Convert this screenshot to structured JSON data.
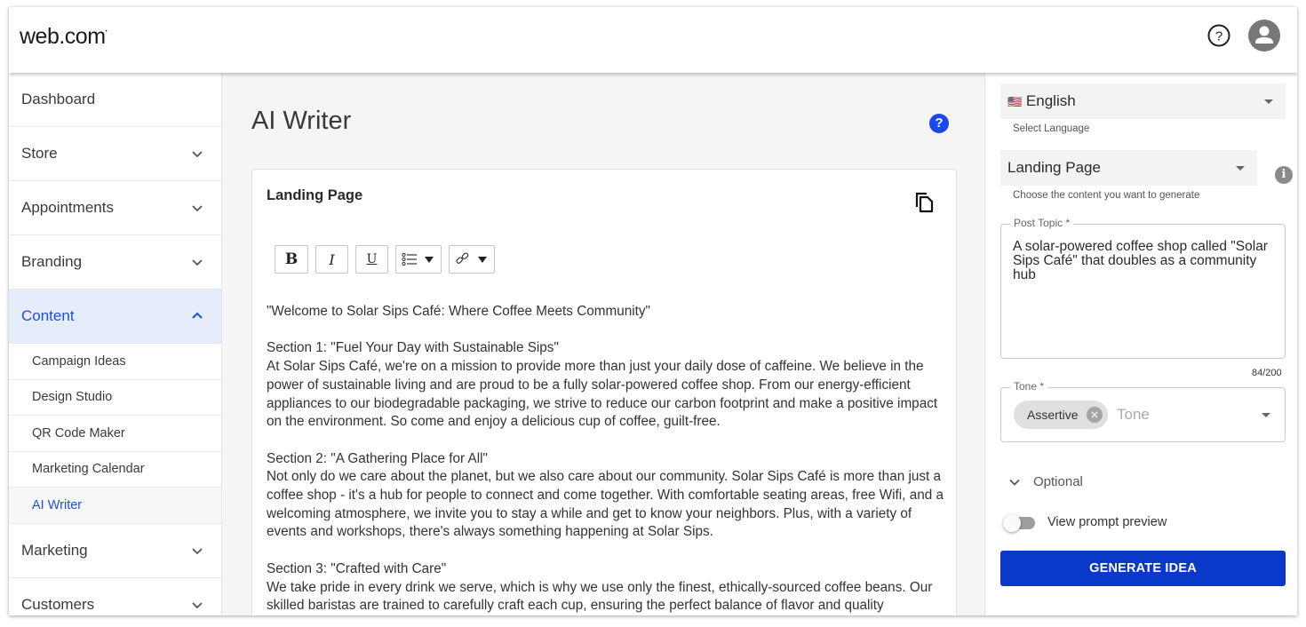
{
  "header": {
    "logo": "web.com",
    "help_icon": "help-circle-icon",
    "avatar_icon": "user-avatar-icon"
  },
  "sidebar": {
    "items": [
      {
        "label": "Dashboard",
        "expandable": false
      },
      {
        "label": "Store",
        "expandable": true,
        "expanded": false
      },
      {
        "label": "Appointments",
        "expandable": true,
        "expanded": false
      },
      {
        "label": "Branding",
        "expandable": true,
        "expanded": false
      },
      {
        "label": "Content",
        "expandable": true,
        "expanded": true,
        "active": true
      },
      {
        "label": "Marketing",
        "expandable": true,
        "expanded": false
      },
      {
        "label": "Customers",
        "expandable": true,
        "expanded": false
      }
    ],
    "content_subitems": [
      {
        "label": "Campaign Ideas"
      },
      {
        "label": "Design Studio"
      },
      {
        "label": "QR Code Maker"
      },
      {
        "label": "Marketing Calendar"
      },
      {
        "label": "AI Writer",
        "active": true
      }
    ]
  },
  "main": {
    "title": "AI Writer",
    "help_icon": "help-circle-filled-icon",
    "card": {
      "title": "Landing Page",
      "copy_icon": "copy-icon",
      "toolbar": {
        "bold": "B",
        "italic": "I",
        "underline": "U",
        "list_icon": "bulleted-list-icon",
        "link_icon": "link-icon"
      },
      "content": [
        "\"Welcome to Solar Sips Café: Where Coffee Meets Community\"",
        "Section 1: \"Fuel Your Day with Sustainable Sips\"\nAt Solar Sips Café, we're on a mission to provide more than just your daily dose of caffeine. We believe in the power of sustainable living and are proud to be a fully solar-powered coffee shop. From our energy-efficient appliances to our biodegradable packaging, we strive to reduce our carbon footprint and make a positive impact on the environment. So come and enjoy a delicious cup of coffee, guilt-free.",
        "Section 2: \"A Gathering Place for All\"\nNot only do we care about the planet, but we also care about our community. Solar Sips Café is more than just a coffee shop - it's a hub for people to connect and come together. With comfortable seating areas, free Wifi, and a welcoming atmosphere, we invite you to stay a while and get to know your neighbors. Plus, with a variety of events and workshops, there's always something happening at Solar Sips.",
        "Section 3: \"Crafted with Care\"\nWe take pride in every drink we serve, which is why we use only the finest, ethically-sourced coffee beans. Our skilled baristas are trained to carefully craft each cup, ensuring the perfect balance of flavor and quality"
      ]
    }
  },
  "panel": {
    "language": {
      "flag": "🇺🇸",
      "value": "English",
      "helper": "Select Language"
    },
    "content_type": {
      "value": "Landing Page",
      "helper": "Choose the content you want to generate",
      "info_icon": "info-icon"
    },
    "post_topic": {
      "label": "Post Topic *",
      "value": "A solar-powered coffee shop called \"Solar Sips Café\" that doubles as a community hub",
      "counter": "84/200"
    },
    "tone": {
      "label": "Tone *",
      "chips": [
        "Assertive"
      ],
      "placeholder": "Tone"
    },
    "optional_label": "Optional",
    "prompt_preview": {
      "label": "View prompt preview",
      "enabled": false
    },
    "generate_button": "GENERATE IDEA"
  },
  "colors": {
    "accent": "#1f4fd6",
    "button": "#0a38c9",
    "active_bg": "#e5ecfb"
  }
}
